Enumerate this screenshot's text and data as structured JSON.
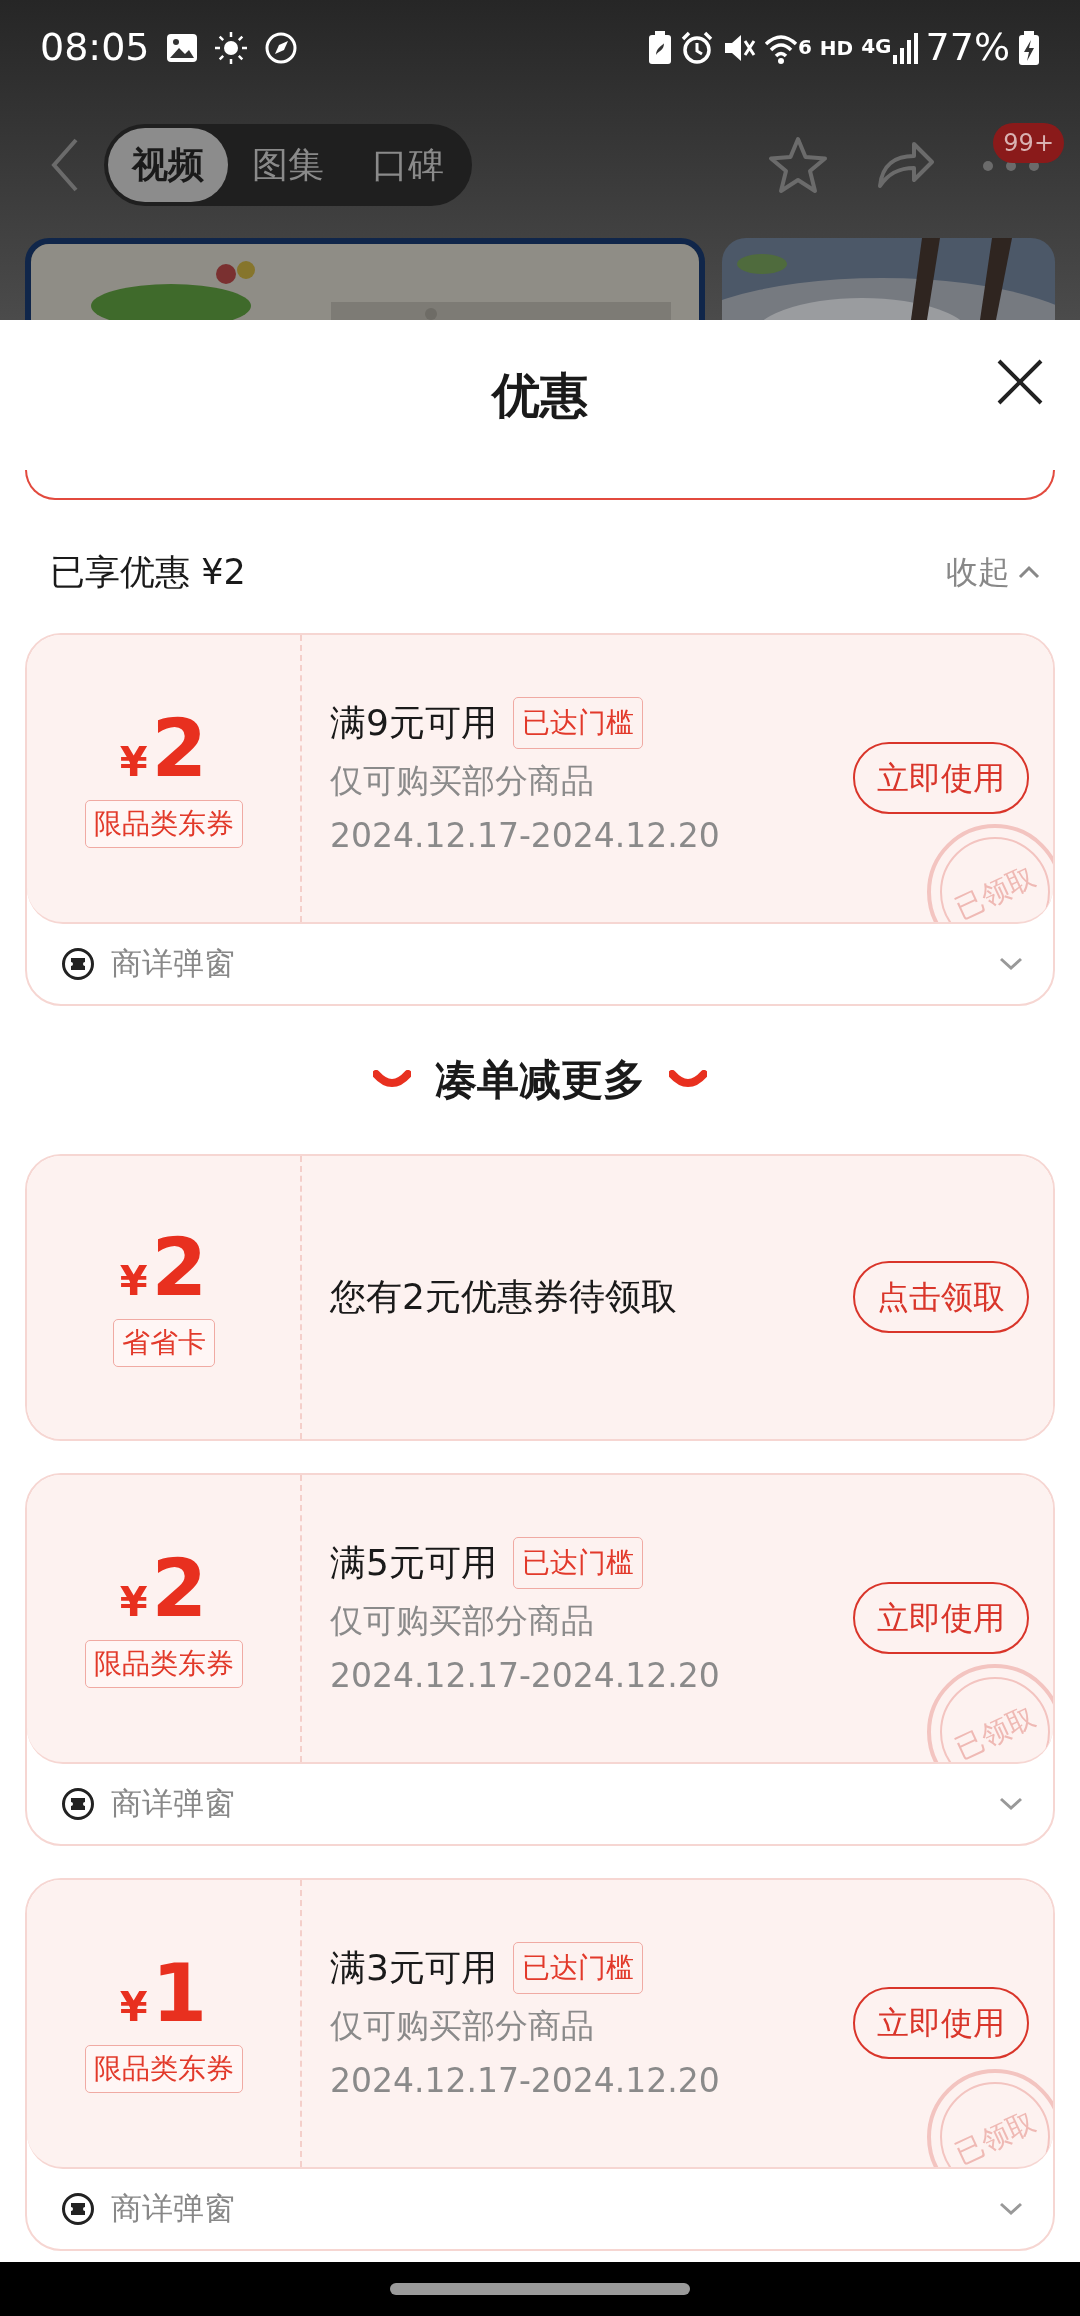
{
  "status_bar": {
    "time": "08:05",
    "wifi_label": "6",
    "hd_label": "HD",
    "network_label": "4G",
    "battery": "77%"
  },
  "page_header": {
    "tabs": [
      {
        "label": "视频",
        "selected": true
      },
      {
        "label": "图集",
        "selected": false
      },
      {
        "label": "口碑",
        "selected": false
      }
    ],
    "badge": "99+"
  },
  "sheet": {
    "title": "优惠",
    "claimed_section": {
      "summary": "已享优惠 ¥2",
      "toggle_label": "收起",
      "expanded": true,
      "coupons": [
        {
          "kind": "claimed",
          "currency": "¥",
          "amount": "2",
          "type_tag": "限品类东券",
          "condition": "满9元可用",
          "threshold_badge": "已达门槛",
          "scope": "仅可购买部分商品",
          "validity": "2024.12.17-2024.12.20",
          "action": "立即使用",
          "stamp": "已领取",
          "footer": "商详弹窗",
          "expanded": false
        }
      ]
    },
    "more_section": {
      "heading": "凑单减更多",
      "coupons": [
        {
          "kind": "offer",
          "currency": "¥",
          "amount": "2",
          "type_tag": "省省卡",
          "message": "您有2元优惠券待领取",
          "action": "点击领取"
        },
        {
          "kind": "claimed",
          "currency": "¥",
          "amount": "2",
          "type_tag": "限品类东券",
          "condition": "满5元可用",
          "threshold_badge": "已达门槛",
          "scope": "仅可购买部分商品",
          "validity": "2024.12.17-2024.12.20",
          "action": "立即使用",
          "stamp": "已领取",
          "footer": "商详弹窗",
          "expanded": false
        },
        {
          "kind": "claimed",
          "currency": "¥",
          "amount": "1",
          "type_tag": "限品类东券",
          "condition": "满3元可用",
          "threshold_badge": "已达门槛",
          "scope": "仅可购买部分商品",
          "validity": "2024.12.17-2024.12.20",
          "action": "立即使用",
          "stamp": "已领取",
          "footer": "商详弹窗",
          "expanded": false
        }
      ]
    }
  }
}
